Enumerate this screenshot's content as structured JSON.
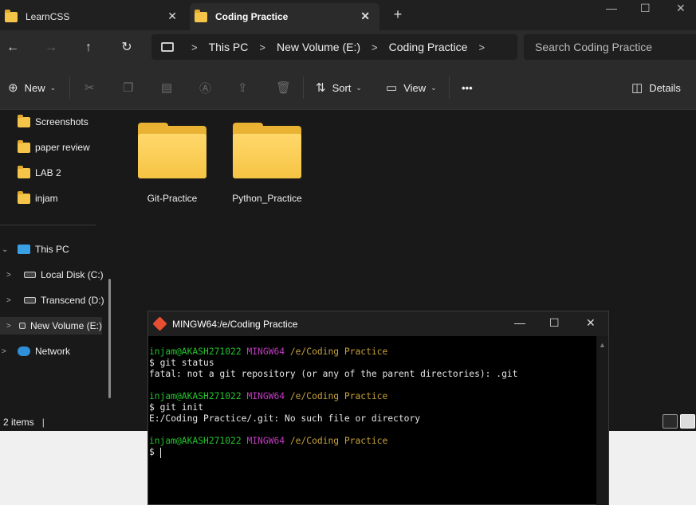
{
  "tabs": [
    {
      "label": "LearnCSS",
      "active": false
    },
    {
      "label": "Coding Practice",
      "active": true
    }
  ],
  "window_controls": {
    "minimize": "—",
    "maximize": "☐",
    "close": "✕"
  },
  "address_bar": {
    "breadcrumbs": [
      "This PC",
      "New Volume (E:)",
      "Coding Practice"
    ],
    "search_placeholder": "Search Coding Practice"
  },
  "toolbar": {
    "new_label": "New",
    "sort_label": "Sort",
    "view_label": "View",
    "more_label": "•••",
    "details_label": "Details"
  },
  "sidebar": {
    "quick_access": [
      {
        "label": "Screenshots"
      },
      {
        "label": "paper review"
      },
      {
        "label": "LAB 2"
      },
      {
        "label": "injam"
      }
    ],
    "this_pc": "This PC",
    "drives": [
      {
        "label": "Local Disk (C:)"
      },
      {
        "label": "Transcend (D:)"
      },
      {
        "label": "New Volume (E:)"
      }
    ],
    "network": "Network"
  },
  "folders": [
    {
      "name": "Git-Practice"
    },
    {
      "name": "Python_Practice"
    }
  ],
  "status": {
    "item_count": "2 items"
  },
  "terminal": {
    "title": "MINGW64:/e/Coding Practice",
    "prompt": {
      "user": "injam@AKASH271022",
      "system": "MINGW64",
      "path": "/e/Coding Practice"
    },
    "blocks": [
      {
        "command": "$ git status",
        "output": "fatal: not a git repository (or any of the parent directories): .git"
      },
      {
        "command": "$ git init",
        "output": "E:/Coding Practice/.git: No such file or directory"
      }
    ],
    "current_prompt": "$ "
  }
}
